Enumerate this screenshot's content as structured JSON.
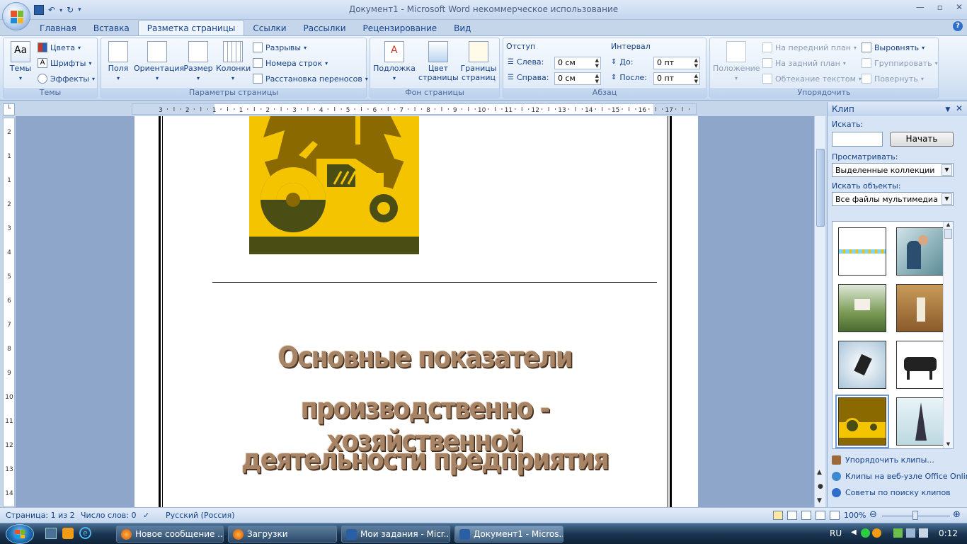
{
  "window": {
    "title": "Документ1 - Microsoft Word некоммерческое использование"
  },
  "tabs": [
    "Главная",
    "Вставка",
    "Разметка страницы",
    "Ссылки",
    "Рассылки",
    "Рецензирование",
    "Вид"
  ],
  "active_tab": "Разметка страницы",
  "ribbon": {
    "themes": {
      "label": "Темы",
      "big": "Темы",
      "colors": "Цвета",
      "fonts": "Шрифты",
      "effects": "Эффекты"
    },
    "page_setup": {
      "label": "Параметры страницы",
      "margins": "Поля",
      "orientation": "Ориентация",
      "size": "Размер",
      "columns": "Колонки",
      "breaks": "Разрывы",
      "line_numbers": "Номера строк",
      "hyphenation": "Расстановка переносов"
    },
    "page_background": {
      "label": "Фон страницы",
      "watermark": "Подложка",
      "page_color_1": "Цвет",
      "page_color_2": "страницы",
      "page_borders_1": "Границы",
      "page_borders_2": "страниц"
    },
    "paragraph": {
      "label": "Абзац",
      "indent": "Отступ",
      "left": "Слева:",
      "right": "Справа:",
      "left_val": "0 см",
      "right_val": "0 см",
      "spacing": "Интервал",
      "before": "До:",
      "after": "После:",
      "before_val": "0 пт",
      "after_val": "0 пт"
    },
    "arrange": {
      "label": "Упорядочить",
      "position": "Положение",
      "bring_front": "На передний план",
      "send_back": "На задний план",
      "text_wrap": "Обтекание текстом",
      "align": "Выровнять",
      "group": "Группировать",
      "rotate": "Повернуть"
    }
  },
  "ruler": {
    "marks": [
      "3",
      "2",
      "1",
      "1",
      "2",
      "3",
      "4",
      "5",
      "6",
      "7",
      "8",
      "9",
      "10",
      "11",
      "12",
      "13",
      "14",
      "15",
      "16",
      "17"
    ],
    "vmarks": [
      "2",
      "1",
      "1",
      "2",
      "3",
      "4",
      "5",
      "6",
      "7",
      "8",
      "9",
      "10",
      "11",
      "12",
      "13",
      "14",
      "15"
    ]
  },
  "document": {
    "heading_lines": [
      "Основные показатели",
      "производственно - хозяйственной",
      "деятельности предприятия"
    ]
  },
  "clip_pane": {
    "title": "Клип",
    "search_label": "Искать:",
    "search_value": "",
    "go_button": "Начать",
    "browse_label": "Просматривать:",
    "browse_value": "Выделенные коллекции",
    "types_label": "Искать объекты:",
    "types_value": "Все файлы мультимедиа",
    "links": [
      "Упорядочить клипы...",
      "Клипы на веб-узле Office Online",
      "Советы по поиску клипов"
    ]
  },
  "status": {
    "page": "Страница: 1 из 2",
    "words": "Число слов: 0",
    "language": "Русский (Россия)",
    "zoom": "100%"
  },
  "taskbar": {
    "items": [
      "Новое сообщение ...",
      "Загрузки",
      "Мои задания - Micr...",
      "Документ1 - Micros..."
    ],
    "lang": "RU",
    "time": "0:12"
  },
  "colors": {
    "ribbon_text": "#15428b",
    "tractor_yellow": "#f5c400",
    "tractor_brown": "#8a6a00",
    "tractor_dark": "#4a4d14"
  }
}
